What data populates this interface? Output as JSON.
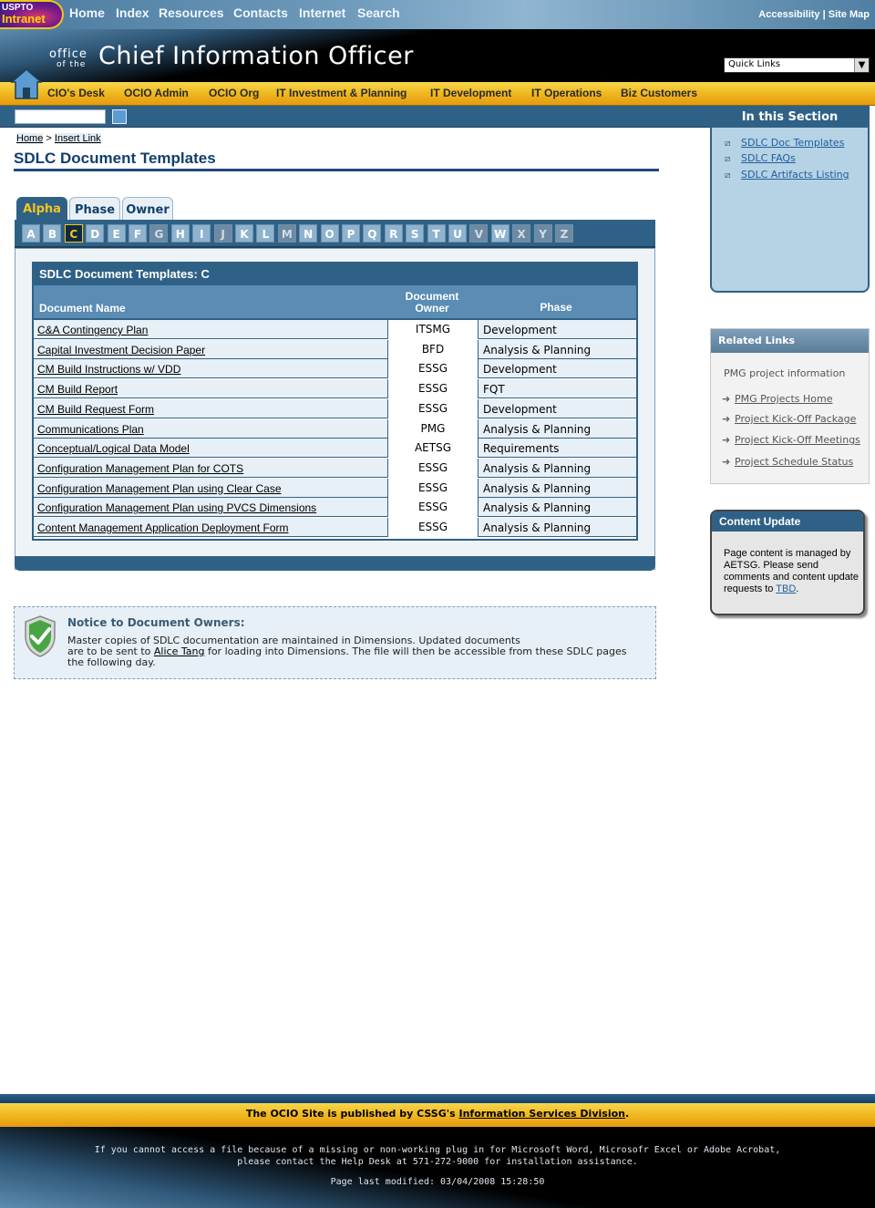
{
  "header": {
    "logo_line1": "USPTO",
    "logo_line2": "Intranet",
    "topnav": [
      "Home",
      "Index",
      "Resources",
      "Contacts",
      "Internet",
      "Search"
    ],
    "accessibility": "Accessibility",
    "separator": "|",
    "sitemap": "Site Map",
    "office": "office",
    "of_the": "of the",
    "site_title": "Chief Information Officer",
    "quick_links": "Quick Links",
    "mainnav": [
      "CIO's Desk",
      "OCIO Admin",
      "OCIO Org",
      "IT Investment & Planning",
      "IT Development",
      "IT Operations",
      "Biz Customers"
    ]
  },
  "breadcrumb": {
    "home": "Home",
    "sep": ">",
    "current": "Insert Link"
  },
  "page_title": "SDLC Document Templates",
  "tabs": [
    "Alpha",
    "Phase",
    "Owner"
  ],
  "letters": [
    "A",
    "B",
    "C",
    "D",
    "E",
    "F",
    "G",
    "H",
    "I",
    "J",
    "K",
    "L",
    "M",
    "N",
    "O",
    "P",
    "Q",
    "R",
    "S",
    "T",
    "U",
    "V",
    "W",
    "X",
    "Y",
    "Z"
  ],
  "active_letter": "C",
  "table": {
    "caption": "SDLC Document Templates: C",
    "col_name": "Document Name",
    "col_owner_1": "Document",
    "col_owner_2": "Owner",
    "col_phase": "Phase",
    "rows": [
      {
        "name": "C&A Contingency Plan",
        "owner": "ITSMG",
        "phase": "Development"
      },
      {
        "name": "Capital Investment Decision Paper",
        "owner": "BFD",
        "phase": "Analysis & Planning"
      },
      {
        "name": "CM Build Instructions w/ VDD",
        "owner": "ESSG",
        "phase": "Development"
      },
      {
        "name": "CM Build Report ",
        "owner": "ESSG",
        "phase": "FQT"
      },
      {
        "name": "CM Build Request Form",
        "owner": "ESSG",
        "phase": "Development"
      },
      {
        "name": "Communications Plan",
        "owner": "PMG",
        "phase": "Analysis & Planning"
      },
      {
        "name": "Conceptual/Logical Data Model",
        "owner": "AETSG",
        "phase": "Requirements"
      },
      {
        "name": "Configuration Management Plan for COTS",
        "owner": "ESSG",
        "phase": "Analysis & Planning"
      },
      {
        "name": "Configuration Management Plan using Clear Case",
        "owner": "ESSG",
        "phase": "Analysis & Planning"
      },
      {
        "name": "Configuration Management Plan using PVCS Dimensions",
        "owner": "ESSG",
        "phase": "Analysis & Planning"
      },
      {
        "name": "Content Management Application Deployment Form",
        "owner": "ESSG",
        "phase": "Analysis & Planning"
      }
    ]
  },
  "notice": {
    "title": "Notice to Document Owners:",
    "line1": "Master copies of SDLC documentation are maintained in Dimensions. Updated documents",
    "line2a": "are to be sent to",
    "link": "Alice Tang",
    "line2b": "for loading into Dimensions. The file will then be accessible from these SDLC pages",
    "line3": "the following day."
  },
  "rail": {
    "section_title": "In this Section",
    "section_links": [
      "SDLC Doc Templates",
      "SDLC FAQs",
      "SDLC Artifacts Listing"
    ],
    "related_title": "Related Links",
    "related_intro": "PMG project information",
    "related_links": [
      "PMG Projects Home",
      "Project Kick-Off Package",
      "Project Kick-Off Meetings",
      "Project Schedule Status"
    ],
    "update_title": "Content Update",
    "update_text": "Page content is managed by AETSG. Please send comments and content update requests to",
    "update_link": "TBD",
    "update_end": "."
  },
  "footer": {
    "published_a": "The OCIO Site is published by CSSG's",
    "published_link": "Information Services Division",
    "published_end": ".",
    "note1": "If you cannot access a file because of a missing or non-working plug in for Microsoft Word, Microsofr Excel  or Adobe Acrobat,",
    "note2": "please contact the Help Desk at 571-272-9000 for installation assistance.",
    "modified": "Page last modified: 03/04/2008 15:28:50"
  },
  "colors": {
    "navy": "#2f6186",
    "gold": "#f0b820",
    "title_blue": "#123f6b",
    "panel_blue": "#b6d2e5"
  }
}
